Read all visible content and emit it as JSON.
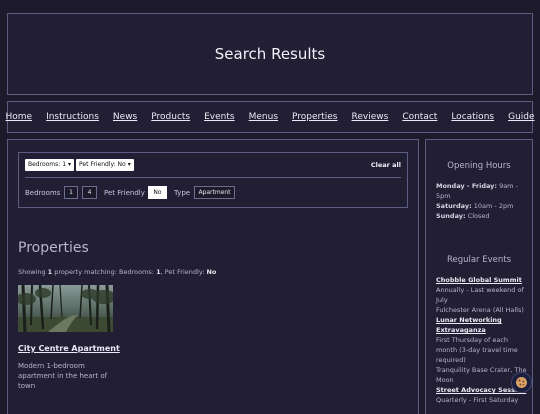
{
  "header": {
    "title": "Search Results"
  },
  "nav": {
    "items": [
      "Home",
      "Instructions",
      "News",
      "Products",
      "Events",
      "Menus",
      "Properties",
      "Reviews",
      "Contact",
      "Locations",
      "Guide"
    ]
  },
  "filters": {
    "chips": [
      {
        "label": "Bedrooms: 1",
        "remove_glyph": "▾"
      },
      {
        "label": "Pet Friendly: No",
        "remove_glyph": "▾"
      }
    ],
    "clear_all": "Clear all",
    "bedrooms_label": "Bedrooms",
    "bedroom_options": [
      "1",
      "4"
    ],
    "pet_label": "Pet Friendly",
    "pet_value": "No",
    "type_label": "Type",
    "type_value": "Apartment"
  },
  "results": {
    "heading": "Properties",
    "summary_prefix": "Showing ",
    "count": "1",
    "summary_mid": " property matching: Bedrooms: ",
    "bedrooms": "1",
    "summary_mid2": ", Pet Friendly: ",
    "pet": "No",
    "card": {
      "title": "City Centre Apartment",
      "description": "Modern 1-bedroom apartment in the heart of town"
    }
  },
  "sidebar": {
    "hours_heading": "Opening Hours",
    "hours": [
      {
        "day": "Monday - Friday:",
        "time": " 9am - 5pm"
      },
      {
        "day": "Saturday:",
        "time": " 10am - 2pm"
      },
      {
        "day": "Sunday:",
        "time": " Closed"
      }
    ],
    "events_heading": "Regular Events",
    "events": [
      {
        "title": "Chobble Global Summit",
        "lines": [
          "Annually - Last weekend of July",
          "Fulchester Arena (All Halls)"
        ]
      },
      {
        "title": "Lunar Networking Extravaganza",
        "lines": [
          "First Thursday of each month (3-day travel time required)",
          "Tranquility Base Crater, The Moon"
        ]
      },
      {
        "title": "Street Advocacy Session",
        "lines": [
          "Quarterly - First Saturday"
        ]
      }
    ]
  },
  "icons": {
    "cookie": "cookie-icon"
  }
}
